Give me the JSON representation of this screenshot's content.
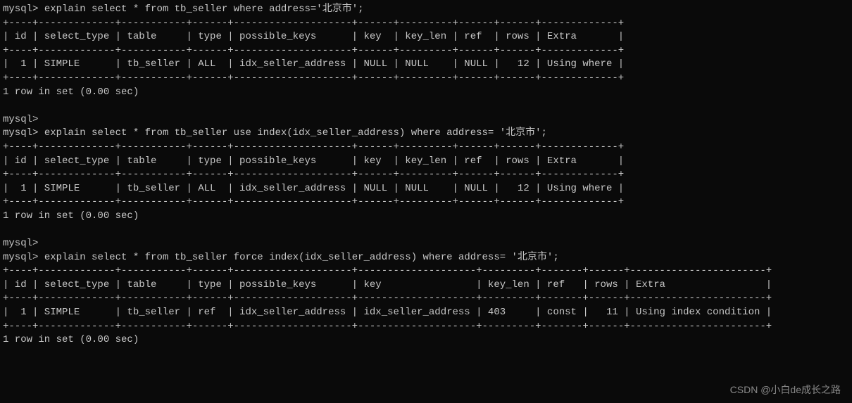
{
  "prompt": "mysql>",
  "queries": {
    "q1": "explain select * from tb_seller where address='北京市';",
    "q2": "explain select * from tb_seller use index(idx_seller_address) where address= '北京市';",
    "q3": "explain select * from tb_seller force index(idx_seller_address) where address= '北京市';"
  },
  "result_footer": "1 row in set (0.00 sec)",
  "blank_prompt": "mysql>",
  "watermark": "CSDN @小白de成长之路",
  "tables": {
    "t1": {
      "sep": "+----+-------------+-----------+------+--------------------+------+---------+------+------+-------------+",
      "hdr": "| id | select_type | table     | type | possible_keys      | key  | key_len | ref  | rows | Extra       |",
      "row": "|  1 | SIMPLE      | tb_seller | ALL  | idx_seller_address | NULL | NULL    | NULL |   12 | Using where |"
    },
    "t2": {
      "sep": "+----+-------------+-----------+------+--------------------+------+---------+------+------+-------------+",
      "hdr": "| id | select_type | table     | type | possible_keys      | key  | key_len | ref  | rows | Extra       |",
      "row": "|  1 | SIMPLE      | tb_seller | ALL  | idx_seller_address | NULL | NULL    | NULL |   12 | Using where |"
    },
    "t3": {
      "sep": "+----+-------------+-----------+------+--------------------+--------------------+---------+-------+------+-----------------------+",
      "hdr": "| id | select_type | table     | type | possible_keys      | key                | key_len | ref   | rows | Extra                 |",
      "row": "|  1 | SIMPLE      | tb_seller | ref  | idx_seller_address | idx_seller_address | 403     | const |   11 | Using index condition |"
    }
  }
}
